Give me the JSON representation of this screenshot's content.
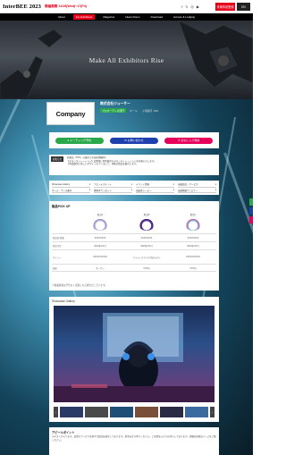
{
  "header": {
    "logo": "InterBEE 2023",
    "dates": "開催期間 11/15(Wed)~17(Fri)",
    "social_icons": [
      "facebook-icon",
      "twitter-icon",
      "instagram-icon",
      "youtube-icon"
    ],
    "register_button": "来場事前登録",
    "lang_button": "EN"
  },
  "nav": {
    "items": [
      "About",
      "For Exhibitors",
      "Magazine",
      "News Room",
      "Download",
      "Access & Lodging"
    ],
    "active_index": 1
  },
  "hero": {
    "title": "Make All Exhibitors Rise"
  },
  "company": {
    "logo_text": "Company",
    "name": "株式会社ジューサー",
    "tags": [
      "プロオーディオ部門",
      "ホール",
      "小間番号 1001"
    ]
  },
  "actions": {
    "buttons": [
      {
        "label": "ミーティング予約",
        "icon": "chat-icon",
        "color": "#2aa84a"
      },
      {
        "label": "お問い合わせ",
        "icon": "mail-icon",
        "color": "#1e3fae"
      },
      {
        "label": "お気に入り登録",
        "icon": "heart-icon",
        "color": "#e6005a"
      }
    ]
  },
  "notice": {
    "label": "お知らせ",
    "lines": [
      "新製品「XXX」の展示と実演を開催中！",
      "【デモンストレーション】会期中に特別展示のデモンストレーションを実施いたします。",
      "【特設展示】新しいデザインのブースにて、多数の製品を展示します。"
    ]
  },
  "categories": {
    "items": [
      "Showcase Gallery",
      "アピールポイント",
      "イベント情報",
      "出展製品・サービス",
      "ホール・ブース番号",
      "資料ダウンロード",
      "出展者ムービー",
      "出展関連ウェビナー"
    ]
  },
  "products": {
    "title": "製品PICK UP",
    "columns": [
      "",
      "製品A",
      "製品B",
      "製品C"
    ],
    "rows": [
      {
        "label": "製品名/型番",
        "values": [
          "XXXXXXXX",
          "XXXXXXXX",
          "XXXXXXXX"
        ]
      },
      {
        "label": "発売予定",
        "values": [
          "2023年XX月",
          "2023年XX月",
          "2023年XX月"
        ]
      },
      {
        "label": "ポイント",
        "values": [
          "XXXXXXXXXX",
          "ワイヤレスマイク対応モデル",
          "XXXXXXXXXX"
        ]
      },
      {
        "label": "価格",
        "values": [
          "オープン",
          "XXX円",
          "XXX円"
        ]
      }
    ],
    "footer": "※掲載情報は予告なく変更になる場合がございます。"
  },
  "gallery": {
    "title": "Showcase Gallery",
    "thumb_count": 6
  },
  "appeal": {
    "title": "アピールポイント",
    "text": "テキストが入ります。会場のブースでは様々な製品を展示しております。是非お立ち寄りください。ご来場を心よりお待ちしております。詳細は各製品ページをご覧ください。"
  },
  "colors": {
    "brand_red": "#e6001a",
    "green": "#2aa84a",
    "blue": "#1e3fae",
    "pink": "#e6005a"
  }
}
